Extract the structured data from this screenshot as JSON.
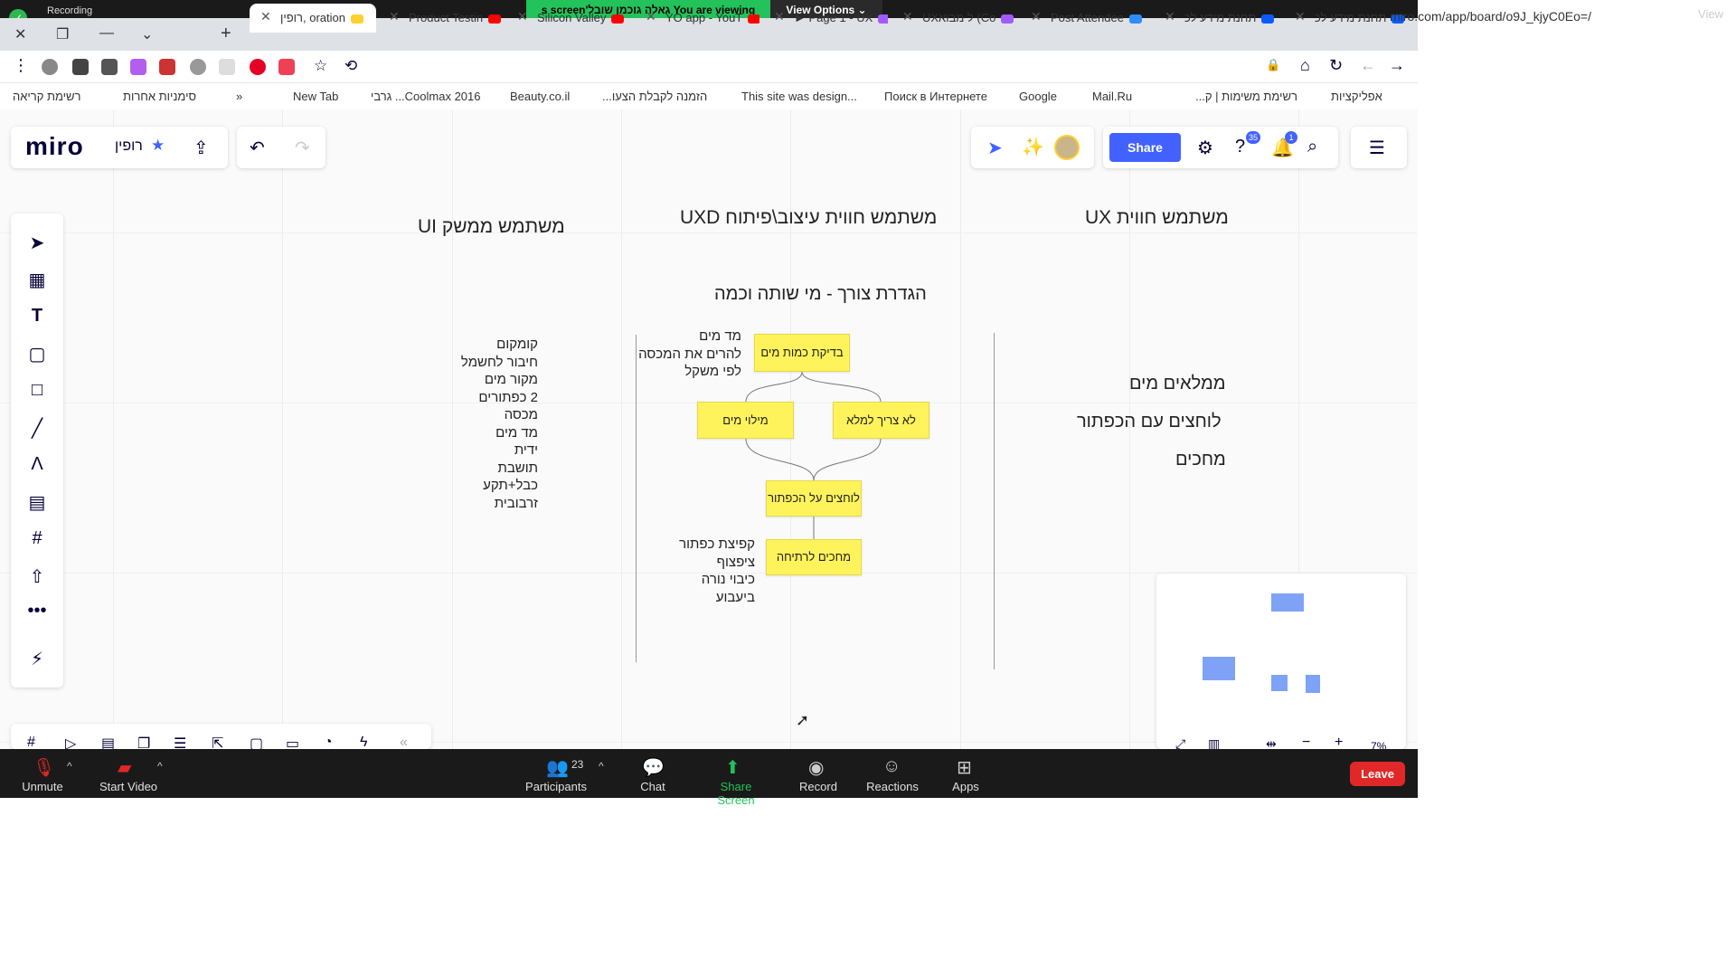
{
  "zoom_banner": {
    "recording": "Recording",
    "viewing": "You are viewing גאלה גוכמן שובל's screen",
    "view_options": "View Options ⌄",
    "view": "View"
  },
  "tabs": [
    {
      "label": "רופין, oration",
      "active": true,
      "fav_color": "#ffd02f"
    },
    {
      "label": "Product Testin",
      "fav_color": "#ff0000"
    },
    {
      "label": "Silicon Valley",
      "fav_color": "#ff0000"
    },
    {
      "label": "YO app - YouT",
      "fav_color": "#ff0000"
    },
    {
      "label": "► Page 1 - UX",
      "fav_color": "#a259ff"
    },
    {
      "label": "UXל מבוא (Co",
      "fav_color": "#a259ff"
    },
    {
      "label": "Post Attendee",
      "fav_color": "#2d8cff"
    },
    {
      "label": "תחנת מידע לכ",
      "fav_color": "#0b5cff"
    },
    {
      "label": "תחנת מידע לכ",
      "fav_color": "#0b5cff"
    }
  ],
  "address_bar": {
    "url": "miro.com/app/board/o9J_kjyC0Eo=/"
  },
  "bookmarks": [
    {
      "label": "רשימת קריאה"
    },
    {
      "label": "סימניות אחרות"
    },
    {
      "label": "»"
    },
    {
      "label": "New Tab"
    },
    {
      "label": "גרבי ...Coolmax 2016"
    },
    {
      "label": "Beauty.co.il"
    },
    {
      "label": "...הזמנה לקבלת הצעו"
    },
    {
      "label": "This site was design..."
    },
    {
      "label": "Поиск в Интернете"
    },
    {
      "label": "Google"
    },
    {
      "label": "Mail.Ru"
    },
    {
      "label": "...רשימת משימות | ק"
    },
    {
      "label": "אפליקציות"
    }
  ],
  "miro": {
    "logo": "miro",
    "board_name": "רופין",
    "share_label": "Share",
    "help_badge": "35",
    "notif_badge": "1",
    "zoom_level": "7%"
  },
  "board": {
    "col_ui_title": "משתמש ממשק UI",
    "col_uxd_title": "משתמש חווית עיצוב\\פיתוח UXD",
    "col_ux_title": "משתמש חווית UX",
    "need_title": "הגדרת צורך - מי שותה וכמה",
    "ui_list": [
      "קומקום",
      "חיבור לחשמל",
      "מקור מים",
      "2 כפתורים",
      "מכסה",
      "מד מים",
      "ידית",
      "תושבת",
      "כבל+תקע",
      "זרבובית"
    ],
    "note_top": [
      "מד מים",
      "להרים את המכסה",
      "לפי משקל"
    ],
    "note_bottom": [
      "קפיצת כפתור",
      "ציפצוף",
      "כיבוי נורה",
      "ביעבוע"
    ],
    "stickies": {
      "check": "בדיקת כמות מים",
      "fill": "מילוי מים",
      "nofill": "לא צריך למלא",
      "press": "לוחצים על הכפתור",
      "wait": "מחכים לרתיחה"
    },
    "ux_items": [
      "ממלאים מים",
      "לוחצים עם הכפתור",
      "מחכים"
    ]
  },
  "zoom_bar": {
    "unmute": "Unmute",
    "start_video": "Start Video",
    "participants": "Participants",
    "participants_count": "23",
    "chat": "Chat",
    "share_screen": "Share Screen",
    "record": "Record",
    "reactions": "Reactions",
    "apps": "Apps",
    "leave": "Leave"
  }
}
